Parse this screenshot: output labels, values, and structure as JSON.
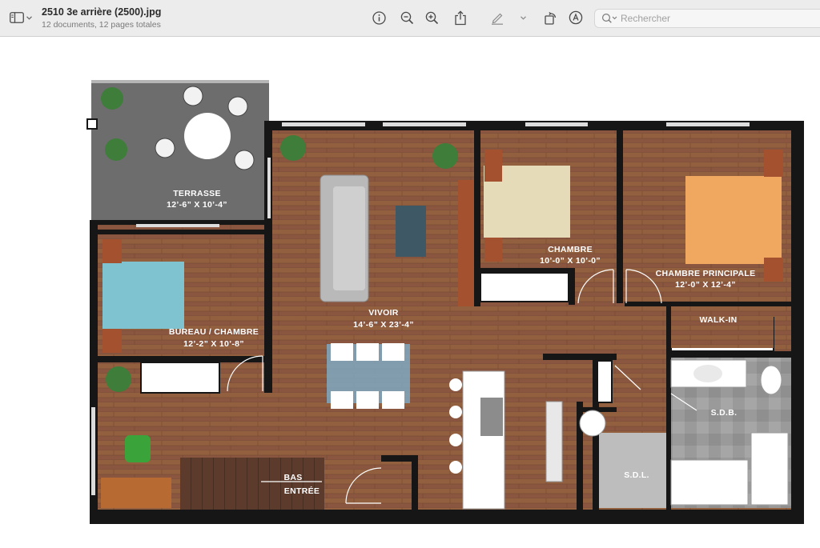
{
  "toolbar": {
    "title": "2510 3e arrière (2500).jpg",
    "subtitle": "12 documents, 12 pages totales",
    "search_placeholder": "Rechercher",
    "icons": [
      "sidebar-icon",
      "chevron-down-icon",
      "info-icon",
      "zoom-out-icon",
      "zoom-in-icon",
      "share-icon",
      "markup-pen-icon",
      "chevron-down-icon",
      "rotate-icon",
      "markup-circle-icon",
      "search-icon"
    ]
  },
  "floorplan": {
    "rooms": [
      {
        "name": "TERRASSE",
        "dims": "12’-6” X 10’-4”"
      },
      {
        "name": "CHAMBRE",
        "dims": "10’-0” X 10’-0”"
      },
      {
        "name": "CHAMBRE PRINCIPALE",
        "dims": "12’-0” X 12’-4”"
      },
      {
        "name": "VIVOIR",
        "dims": "14’-6” X 23’-4”"
      },
      {
        "name": "BUREAU / CHAMBRE",
        "dims": "12’-2” X 10’-8”"
      },
      {
        "name": "WALK-IN",
        "dims": ""
      },
      {
        "name": "S.D.B.",
        "dims": ""
      },
      {
        "name": "S.D.L.",
        "dims": ""
      },
      {
        "name": "BAS",
        "dims": ""
      },
      {
        "name": "ENTRÉE",
        "dims": ""
      }
    ],
    "colors": {
      "floor": "#8a5640",
      "wall": "#161616",
      "terrace": "#6d6d6d",
      "tile": "#9a9a9a"
    }
  }
}
